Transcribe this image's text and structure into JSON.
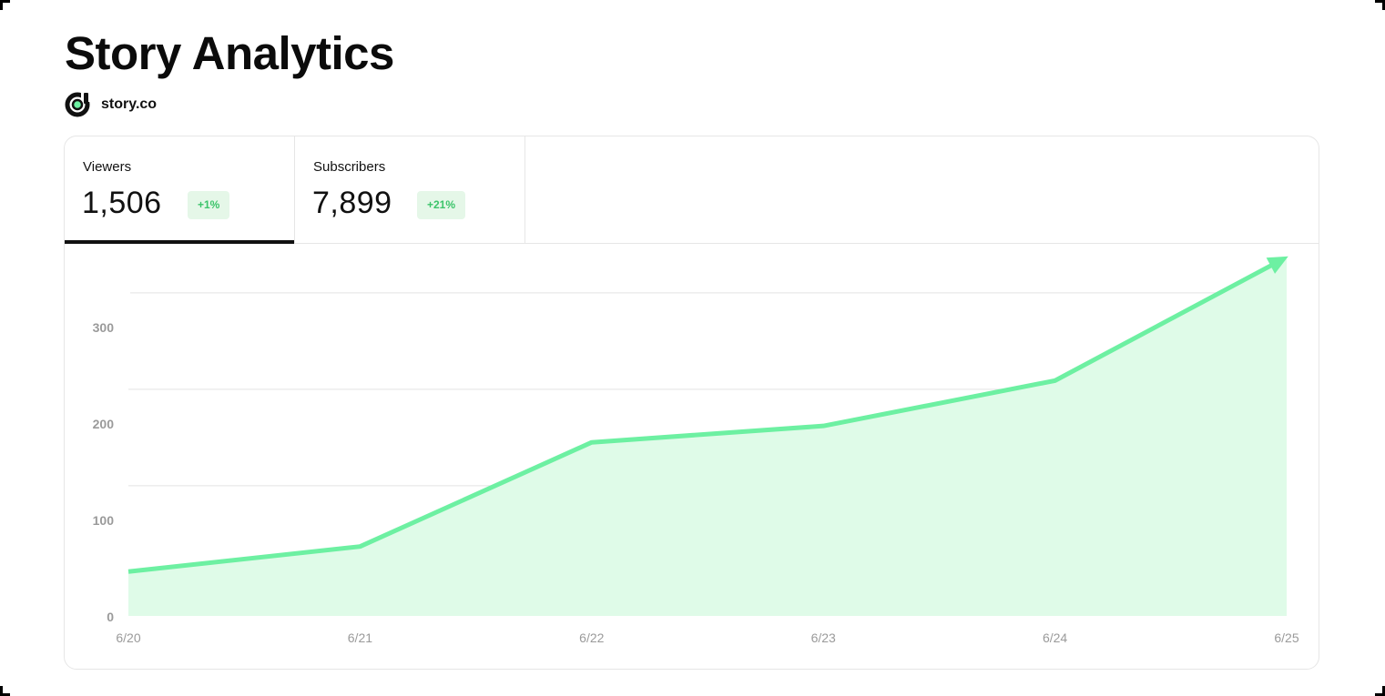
{
  "header": {
    "title": "Story Analytics",
    "brand": "story.co"
  },
  "tabs": [
    {
      "label": "Viewers",
      "value": "1,506",
      "change": "+1%",
      "active": true
    },
    {
      "label": "Subscribers",
      "value": "7,899",
      "change": "+21%",
      "active": false
    }
  ],
  "colors": {
    "line": "#6df0a2",
    "area": "#dffbe8",
    "badge_bg": "#e5f7e8",
    "badge_text": "#3cc46a",
    "grid": "#e3e3e3",
    "axis_text": "#9a9a9a"
  },
  "chart_data": {
    "type": "area",
    "x": [
      "6/20",
      "6/21",
      "6/22",
      "6/23",
      "6/24",
      "6/25"
    ],
    "series": [
      {
        "values": [
          46,
          72,
          180,
          197,
          244,
          372
        ]
      }
    ],
    "yticks": [
      0,
      100,
      200,
      300
    ],
    "ylim": [
      0,
      335
    ],
    "grid": true,
    "end_marker": "arrow",
    "title": "",
    "xlabel": "",
    "ylabel": ""
  }
}
